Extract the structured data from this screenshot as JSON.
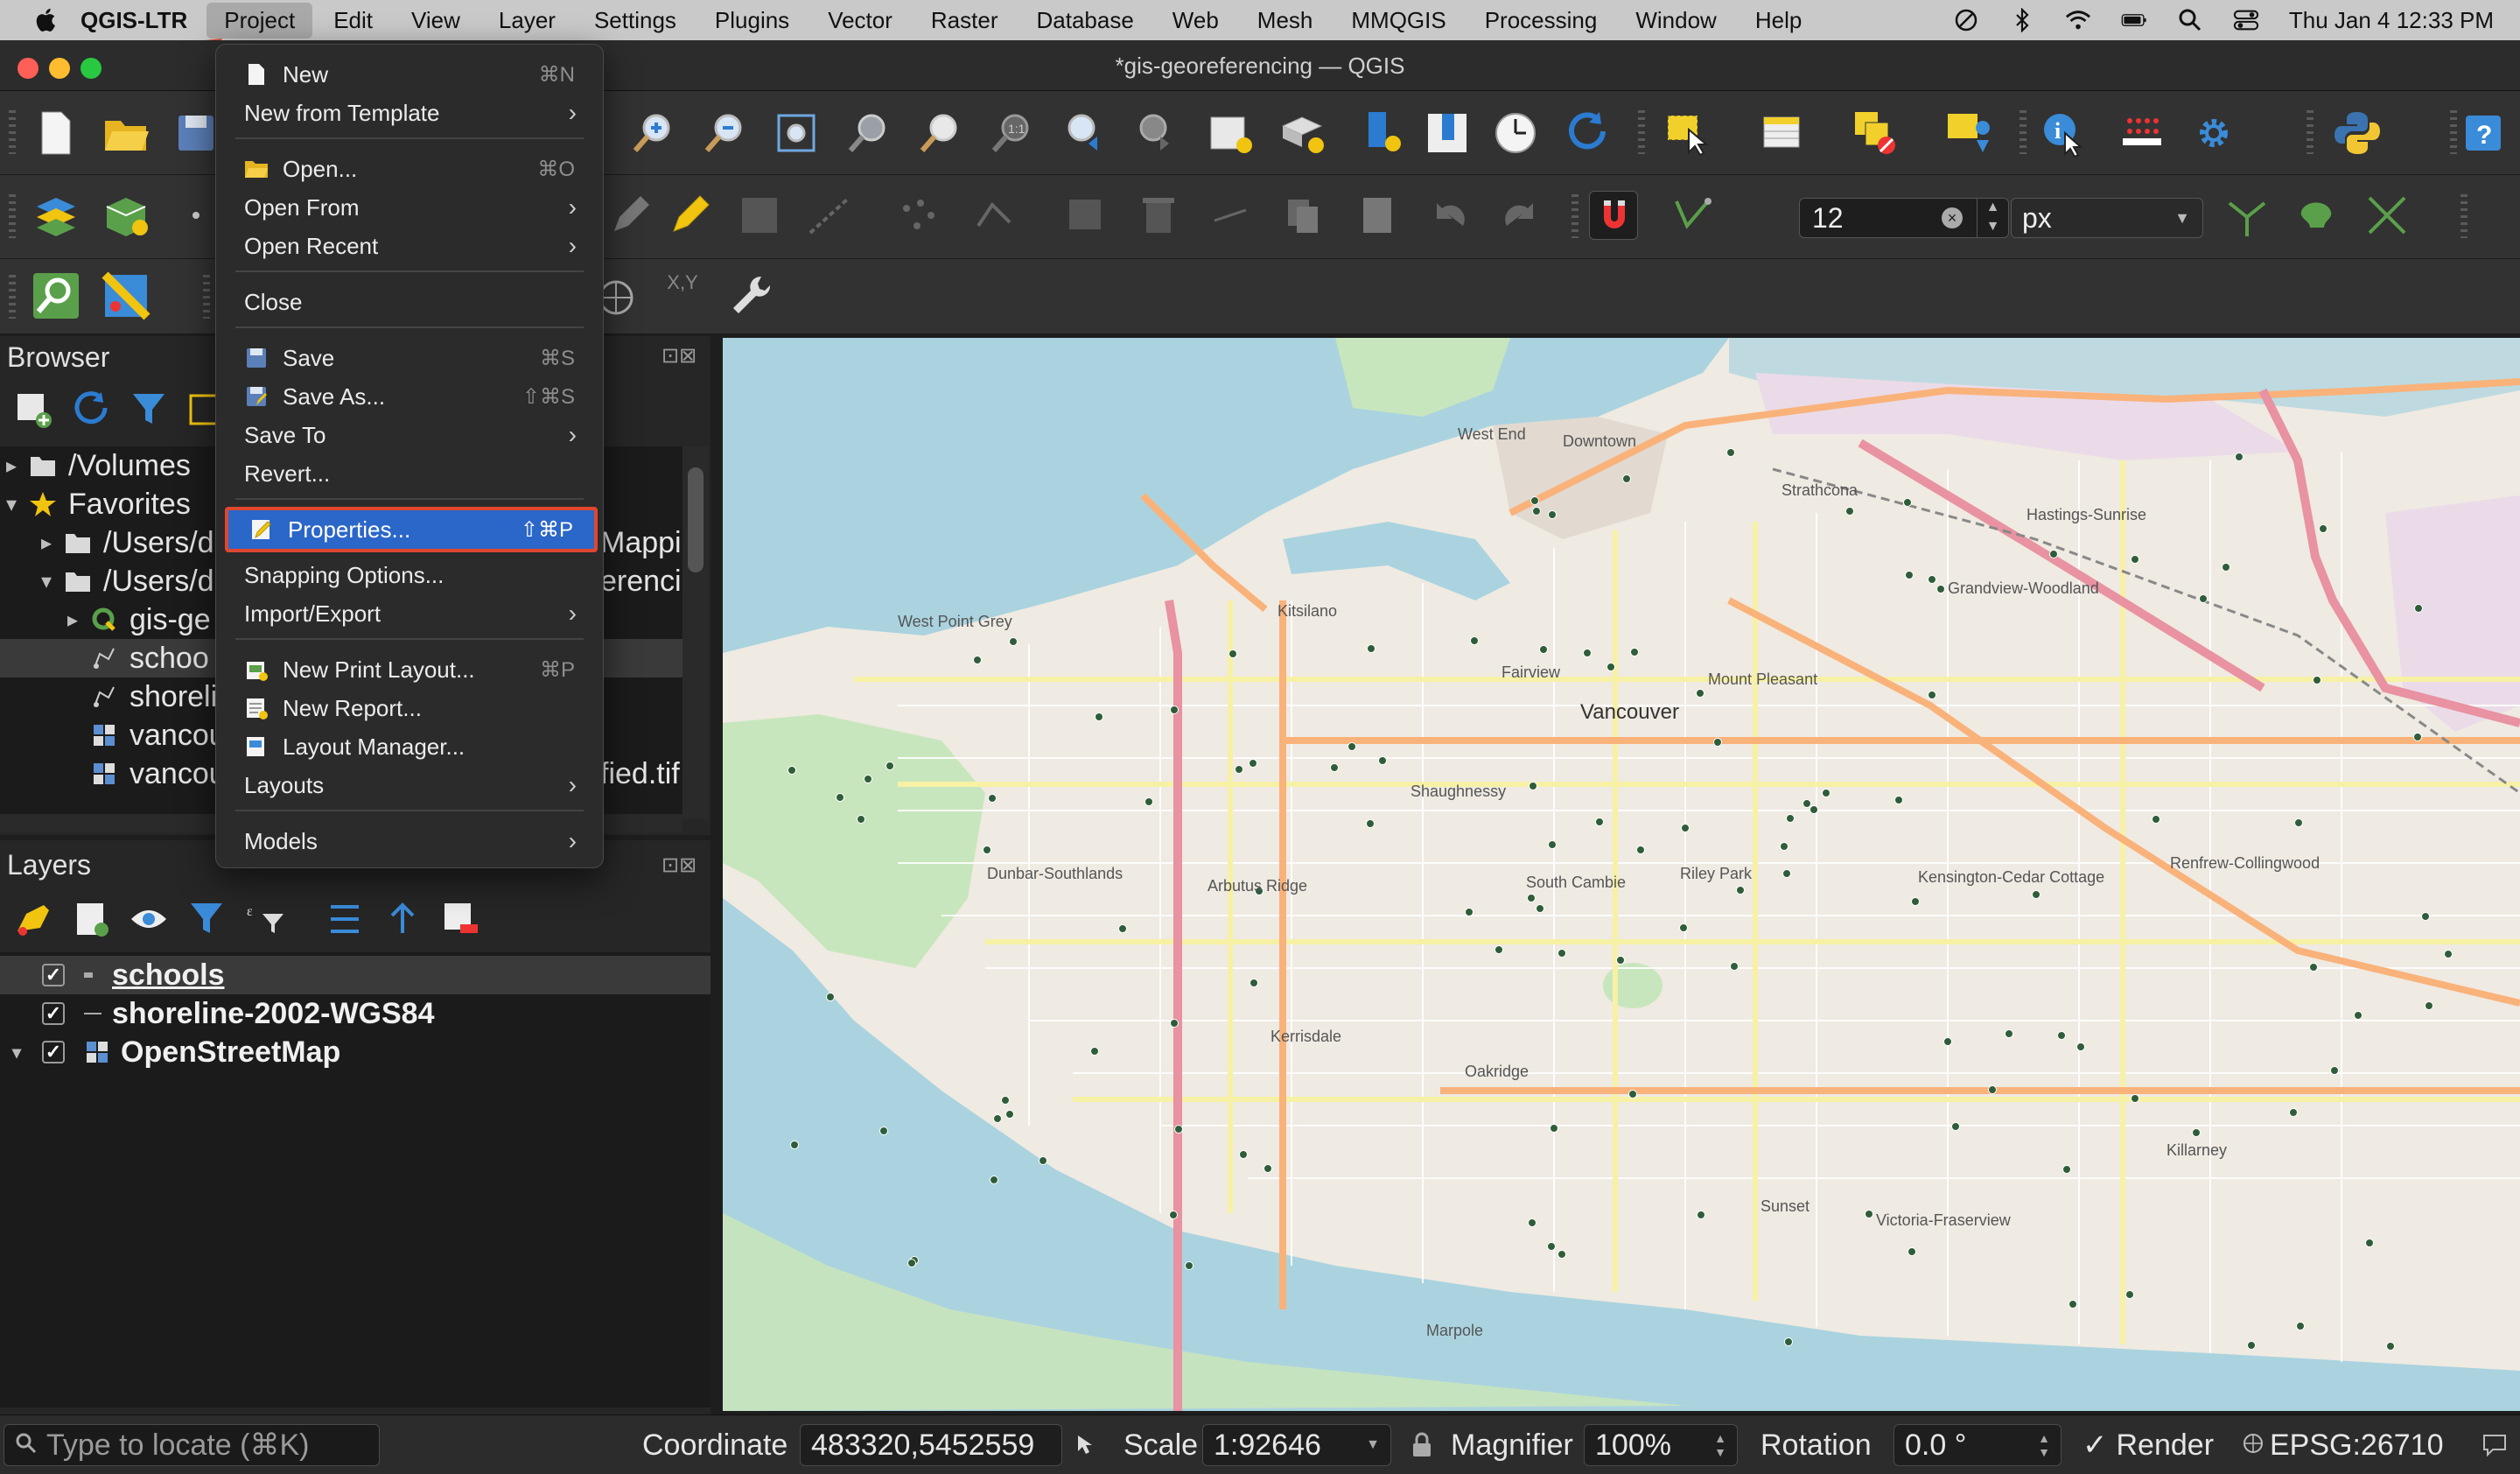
{
  "menubar": {
    "app_name": "QGIS-LTR",
    "items": [
      "Project",
      "Edit",
      "View",
      "Layer",
      "Settings",
      "Plugins",
      "Vector",
      "Raster",
      "Database",
      "Web",
      "Mesh",
      "MMQGIS",
      "Processing",
      "Window",
      "Help"
    ],
    "clock": "Thu Jan 4  12:33 PM"
  },
  "window": {
    "title": "*gis-georeferencing — QGIS"
  },
  "toolbar": {
    "snap_tolerance": "12",
    "snap_units": "px",
    "xy_label": "X,Y"
  },
  "project_menu": {
    "items": [
      {
        "label": "New",
        "shortcut": "⌘N",
        "icon": "new-file-icon"
      },
      {
        "label": "New from Template",
        "submenu": true
      },
      {
        "label": "Open...",
        "shortcut": "⌘O",
        "icon": "folder-icon"
      },
      {
        "label": "Open From",
        "submenu": true
      },
      {
        "label": "Open Recent",
        "submenu": true
      },
      {
        "label": "Close"
      },
      {
        "label": "Save",
        "shortcut": "⌘S",
        "icon": "save-icon"
      },
      {
        "label": "Save As...",
        "shortcut": "⇧⌘S",
        "icon": "save-as-icon"
      },
      {
        "label": "Save To",
        "submenu": true
      },
      {
        "label": "Revert..."
      },
      {
        "label": "Properties...",
        "shortcut": "⇧⌘P",
        "icon": "properties-icon",
        "highlighted": true
      },
      {
        "label": "Snapping Options..."
      },
      {
        "label": "Import/Export",
        "submenu": true
      },
      {
        "label": "New Print Layout...",
        "shortcut": "⌘P",
        "icon": "print-layout-icon"
      },
      {
        "label": "New Report...",
        "icon": "report-icon"
      },
      {
        "label": "Layout Manager...",
        "icon": "layout-manager-icon"
      },
      {
        "label": "Layouts",
        "submenu": true
      },
      {
        "label": "Models",
        "submenu": true
      }
    ]
  },
  "browser": {
    "title": "Browser",
    "tree": [
      {
        "label": "/Volumes",
        "type": "folder",
        "level": 0,
        "arrow": "▸"
      },
      {
        "label": "Favorites",
        "type": "star",
        "level": 0,
        "arrow": "▾"
      },
      {
        "label": "/Users/d",
        "suffix": "Mappi",
        "type": "folder",
        "level": 1,
        "arrow": "▸"
      },
      {
        "label": "/Users/d",
        "suffix": "erencin",
        "type": "folder",
        "level": 1,
        "arrow": "▾"
      },
      {
        "label": "gis-ge",
        "type": "qgis",
        "level": 2,
        "arrow": "▸"
      },
      {
        "label": "schoo",
        "type": "vector",
        "level": 2,
        "arrow": "",
        "selected": true
      },
      {
        "label": "shoreli",
        "type": "vector",
        "level": 2,
        "arrow": ""
      },
      {
        "label": "vancou",
        "type": "raster",
        "level": 2,
        "arrow": ""
      },
      {
        "label": "vancou",
        "suffix": "fied.tif",
        "type": "raster",
        "level": 2,
        "arrow": ""
      }
    ]
  },
  "layers": {
    "title": "Layers",
    "items": [
      {
        "name": "schools",
        "checked": true,
        "selected": true
      },
      {
        "name": "shoreline-2002-WGS84",
        "checked": true
      },
      {
        "name": "OpenStreetMap",
        "checked": true,
        "expanded": true
      }
    ]
  },
  "map": {
    "labels": [
      "West End",
      "Downtown",
      "Strathcona",
      "Hastings-Sunrise",
      "Kitsilano",
      "Grandview-Woodland",
      "West Point Grey",
      "Fairview",
      "Vancouver",
      "Mount Pleasant",
      "Shaughnessy",
      "Dunbar-Southlands",
      "Arbutus Ridge",
      "South Cambie",
      "Riley Park",
      "Kensington-Cedar Cottage",
      "Renfrew-Collingwood",
      "Kerrisdale",
      "Oakridge",
      "Killarney",
      "Sunset",
      "Victoria-Fraserview",
      "Marpole"
    ]
  },
  "statusbar": {
    "locate_placeholder": "Type to locate (⌘K)",
    "coordinate_label": "Coordinate",
    "coordinate_value": "483320,5452559",
    "scale_label": "Scale",
    "scale_value": "1:92646",
    "magnifier_label": "Magnifier",
    "magnifier_value": "100%",
    "rotation_label": "Rotation",
    "rotation_value": "0.0 °",
    "render_label": "Render",
    "crs": "EPSG:26710"
  },
  "colors": {
    "menu_highlight": "#2b66c9",
    "annotation_red": "#e0472f",
    "map_water": "#aad3df",
    "map_land": "#efeae2",
    "school_dot": "#2f5d3a"
  }
}
